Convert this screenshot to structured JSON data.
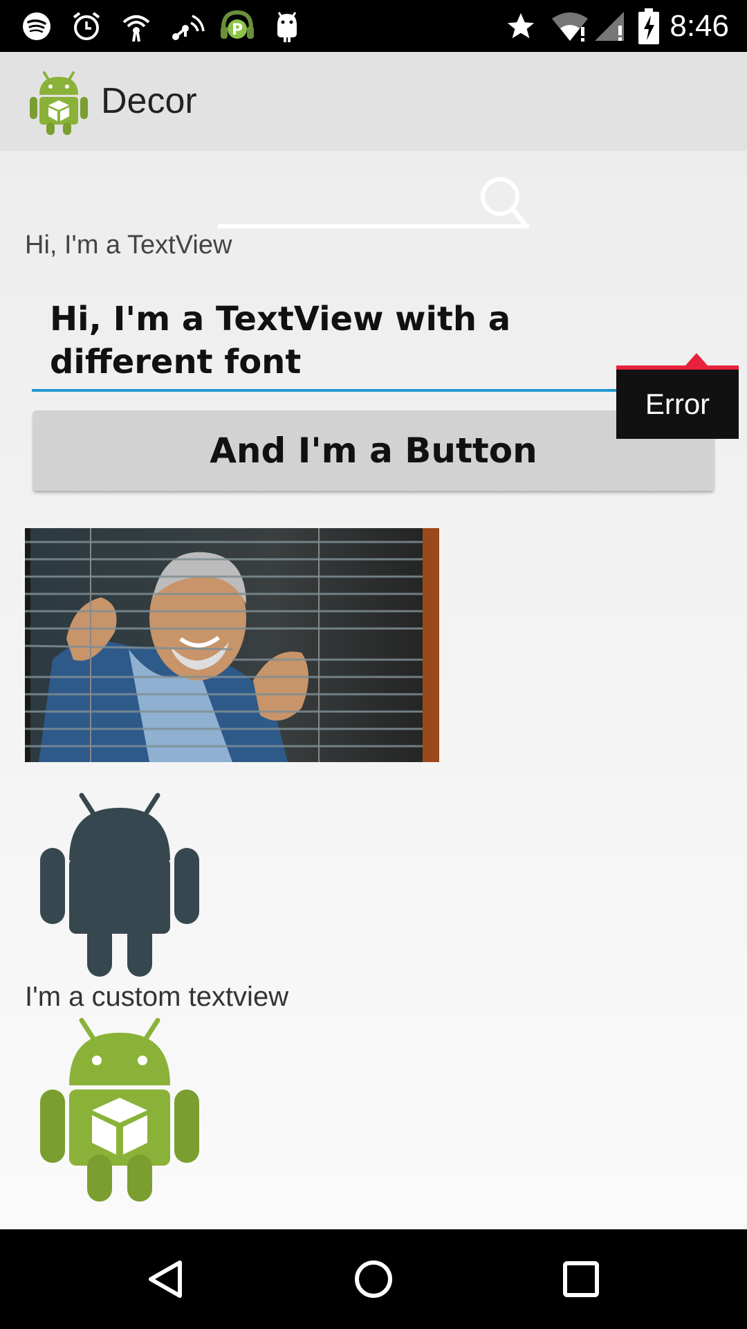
{
  "status_bar": {
    "time": "8:46",
    "icons_left": [
      "spotify-icon",
      "alarm-icon",
      "wifi-hotspot-icon",
      "cast-icon",
      "podcast-app-icon",
      "android-debug-icon"
    ],
    "icons_right": [
      "star-icon",
      "wifi-icon",
      "signal-icon",
      "battery-charging-icon"
    ]
  },
  "app_bar": {
    "title": "Decor",
    "logo": "android-cube-logo"
  },
  "main": {
    "search": {
      "icon": "search-icon"
    },
    "textview_1": "Hi, I'm a TextView",
    "edit_text": {
      "value": "Hi, I'm a TextView with a different font"
    },
    "error_popup": {
      "text": "Error",
      "color": "#e8213c"
    },
    "button": {
      "label": "And I'm a Button"
    },
    "photo": {
      "description_icon": "photo-image"
    },
    "dark_android": {
      "icon": "android-robot-icon",
      "color": "#37474f"
    },
    "custom_textview": "I'm a custom textview",
    "green_android": {
      "icon": "android-cube-logo",
      "color": "#8bb238"
    }
  },
  "nav_bar": {
    "back": "back-icon",
    "home": "home-icon",
    "recents": "recents-icon"
  },
  "colors": {
    "accent": "#2299cc",
    "error": "#e8213c",
    "android_green": "#8bb238"
  }
}
